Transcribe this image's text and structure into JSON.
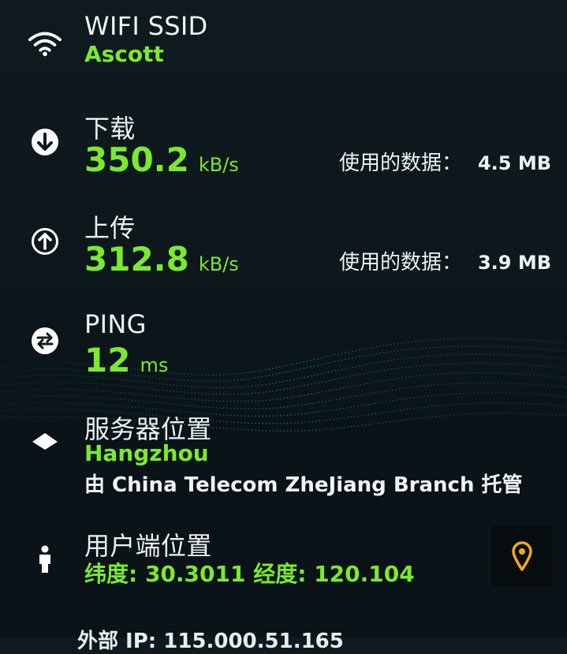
{
  "wifi": {
    "label": "WIFI SSID",
    "value": "Ascott",
    "icon": "wifi-icon"
  },
  "download": {
    "label": "下载",
    "value": "350.2",
    "unit": "kB/s",
    "data_used_label": "使用的数据：",
    "data_used_value": "4.5 MB",
    "icon": "download-arrow-icon"
  },
  "upload": {
    "label": "上传",
    "value": "312.8",
    "unit": "kB/s",
    "data_used_label": "使用的数据：",
    "data_used_value": "3.9 MB",
    "icon": "upload-arrow-icon"
  },
  "ping": {
    "label": "PING",
    "value": "12",
    "unit": "ms",
    "icon": "ping-exchange-icon"
  },
  "server": {
    "label": "服务器位置",
    "city": "Hangzhou",
    "host_text": "由 China Telecom ZheJiang Branch 托管",
    "icon": "server-icon"
  },
  "client": {
    "label": "用户端位置",
    "coords": "纬度: 30.3011  经度: 120.104",
    "icon": "person-icon",
    "map_button_icon": "map-pin-icon"
  },
  "external_ip": {
    "text": "外部 IP:  115.000.51.165"
  },
  "colors": {
    "accent": "#7bea2c",
    "background": "#0d181c",
    "text": "#eef2f2",
    "pin": "#f3a81c"
  }
}
